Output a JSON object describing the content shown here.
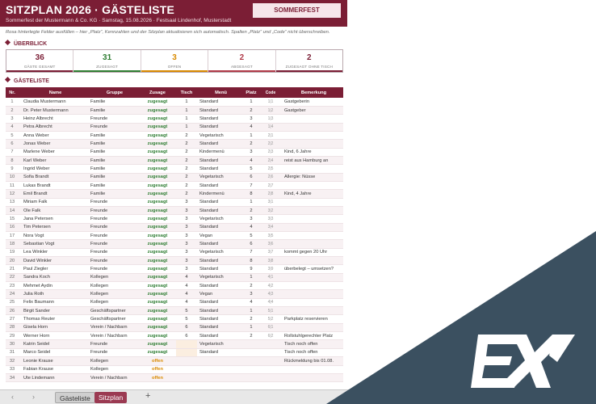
{
  "header": {
    "title": "SITZPLAN 2026  ·  GÄSTELISTE",
    "subtitle": "Sommerfest der Mustermann & Co. KG  ·  Samstag, 15.08.2026  ·  Festsaal Lindenhof, Musterstadt",
    "event_label": "SOMMERFEST"
  },
  "hint": "Rosa hinterlegte Felder ausfüllen – hier „Platz“, Kennzahlen und der Sitzplan aktualisieren sich automatisch. Spalten „Platz“ und „Code“ nicht überschreiben.",
  "overview": {
    "title": "ÜBERBLICK",
    "kpis": [
      {
        "value": "36",
        "label": "GÄSTE GESAMT",
        "color": "#7b1e35",
        "bar": "#7b1e35"
      },
      {
        "value": "31",
        "label": "ZUGESAGT",
        "color": "#2e7d32",
        "bar": "#2e7d32"
      },
      {
        "value": "3",
        "label": "OFFEN",
        "color": "#d98a00",
        "bar": "#d98a00"
      },
      {
        "value": "2",
        "label": "ABGESAGT",
        "color": "#b03a48",
        "bar": "#b03a48"
      },
      {
        "value": "2",
        "label": "ZUGESAGT OHNE TISCH",
        "color": "#7b1e35",
        "bar": "#7b1e35"
      }
    ]
  },
  "guestlist": {
    "title": "GÄSTELISTE",
    "columns": [
      "Nr.",
      "Name",
      "Gruppe",
      "Zusage",
      "Tisch",
      "Menü",
      "Platz",
      "Code",
      "Bemerkung"
    ],
    "rows": [
      [
        "1",
        "Claudia Mustermann",
        "Familie",
        "zugesagt",
        "1",
        "Standard",
        "1",
        "1|1",
        "Gastgeberin"
      ],
      [
        "2",
        "Dr. Peter Mustermann",
        "Familie",
        "zugesagt",
        "1",
        "Standard",
        "2",
        "1|2",
        "Gastgeber"
      ],
      [
        "3",
        "Heinz Albrecht",
        "Freunde",
        "zugesagt",
        "1",
        "Standard",
        "3",
        "1|3",
        ""
      ],
      [
        "4",
        "Petra Albrecht",
        "Freunde",
        "zugesagt",
        "1",
        "Standard",
        "4",
        "1|4",
        ""
      ],
      [
        "5",
        "Anna Weber",
        "Familie",
        "zugesagt",
        "2",
        "Vegetarisch",
        "1",
        "2|1",
        ""
      ],
      [
        "6",
        "Jonas Weber",
        "Familie",
        "zugesagt",
        "2",
        "Standard",
        "2",
        "2|2",
        ""
      ],
      [
        "7",
        "Marlene Weber",
        "Familie",
        "zugesagt",
        "2",
        "Kindermenü",
        "3",
        "2|3",
        "Kind, 6 Jahre"
      ],
      [
        "8",
        "Karl Weber",
        "Familie",
        "zugesagt",
        "2",
        "Standard",
        "4",
        "2|4",
        "reist aus Hamburg an"
      ],
      [
        "9",
        "Ingrid Weber",
        "Familie",
        "zugesagt",
        "2",
        "Standard",
        "5",
        "2|5",
        ""
      ],
      [
        "10",
        "Sofia Brandt",
        "Familie",
        "zugesagt",
        "2",
        "Vegetarisch",
        "6",
        "2|6",
        "Allergie: Nüsse"
      ],
      [
        "11",
        "Lukas Brandt",
        "Familie",
        "zugesagt",
        "2",
        "Standard",
        "7",
        "2|7",
        ""
      ],
      [
        "12",
        "Emil Brandt",
        "Familie",
        "zugesagt",
        "2",
        "Kindermenü",
        "8",
        "2|8",
        "Kind, 4 Jahre"
      ],
      [
        "13",
        "Miriam Falk",
        "Freunde",
        "zugesagt",
        "3",
        "Standard",
        "1",
        "3|1",
        ""
      ],
      [
        "14",
        "Ole Falk",
        "Freunde",
        "zugesagt",
        "3",
        "Standard",
        "2",
        "3|2",
        ""
      ],
      [
        "15",
        "Jana Petersen",
        "Freunde",
        "zugesagt",
        "3",
        "Vegetarisch",
        "3",
        "3|3",
        ""
      ],
      [
        "16",
        "Tim Petersen",
        "Freunde",
        "zugesagt",
        "3",
        "Standard",
        "4",
        "3|4",
        ""
      ],
      [
        "17",
        "Nora Vogt",
        "Freunde",
        "zugesagt",
        "3",
        "Vegan",
        "5",
        "3|5",
        ""
      ],
      [
        "18",
        "Sebastian Vogt",
        "Freunde",
        "zugesagt",
        "3",
        "Standard",
        "6",
        "3|6",
        ""
      ],
      [
        "19",
        "Lea Winkler",
        "Freunde",
        "zugesagt",
        "3",
        "Vegetarisch",
        "7",
        "3|7",
        "kommt gegen 20 Uhr"
      ],
      [
        "20",
        "David Winkler",
        "Freunde",
        "zugesagt",
        "3",
        "Standard",
        "8",
        "3|8",
        ""
      ],
      [
        "21",
        "Paul Ziegler",
        "Freunde",
        "zugesagt",
        "3",
        "Standard",
        "9",
        "3|9",
        "überbelegt – umsetzen?"
      ],
      [
        "22",
        "Sandra Koch",
        "Kollegen",
        "zugesagt",
        "4",
        "Vegetarisch",
        "1",
        "4|1",
        ""
      ],
      [
        "23",
        "Mehmet Aydin",
        "Kollegen",
        "zugesagt",
        "4",
        "Standard",
        "2",
        "4|2",
        ""
      ],
      [
        "24",
        "Julia Roth",
        "Kollegen",
        "zugesagt",
        "4",
        "Vegan",
        "3",
        "4|3",
        ""
      ],
      [
        "25",
        "Felix Baumann",
        "Kollegen",
        "zugesagt",
        "4",
        "Standard",
        "4",
        "4|4",
        ""
      ],
      [
        "26",
        "Birgit Sander",
        "Geschäftspartner",
        "zugesagt",
        "5",
        "Standard",
        "1",
        "5|1",
        ""
      ],
      [
        "27",
        "Thomas Reuter",
        "Geschäftspartner",
        "zugesagt",
        "5",
        "Standard",
        "2",
        "5|2",
        "Parkplatz reservieren"
      ],
      [
        "28",
        "Gisela Horn",
        "Verein / Nachbarn",
        "zugesagt",
        "6",
        "Standard",
        "1",
        "6|1",
        ""
      ],
      [
        "29",
        "Werner Horn",
        "Verein / Nachbarn",
        "zugesagt",
        "6",
        "Standard",
        "2",
        "6|2",
        "Rollstuhlgerechter Platz"
      ],
      [
        "30",
        "Katrin Seidel",
        "Freunde",
        "zugesagt",
        "",
        "Vegetarisch",
        "",
        "",
        "Tisch noch offen"
      ],
      [
        "31",
        "Marco Seidel",
        "Freunde",
        "zugesagt",
        "",
        "Standard",
        "",
        "",
        "Tisch noch offen"
      ],
      [
        "32",
        "Leonie Krause",
        "Kollegen",
        "offen",
        "",
        "",
        "",
        "",
        "Rückmeldung bis 01.08."
      ],
      [
        "33",
        "Fabian Krause",
        "Kollegen",
        "offen",
        "",
        "",
        "",
        "",
        ""
      ],
      [
        "34",
        "Ute Lindemann",
        "Verein / Nachbarn",
        "offen",
        "",
        "",
        "",
        "",
        ""
      ]
    ]
  },
  "tabs": {
    "nav_prev": "‹",
    "nav_next": "›",
    "tab1": "Gästeliste",
    "tab2": "Sitzplan",
    "add": "+"
  },
  "watermark": {
    "icon": "ex-logo-icon"
  }
}
